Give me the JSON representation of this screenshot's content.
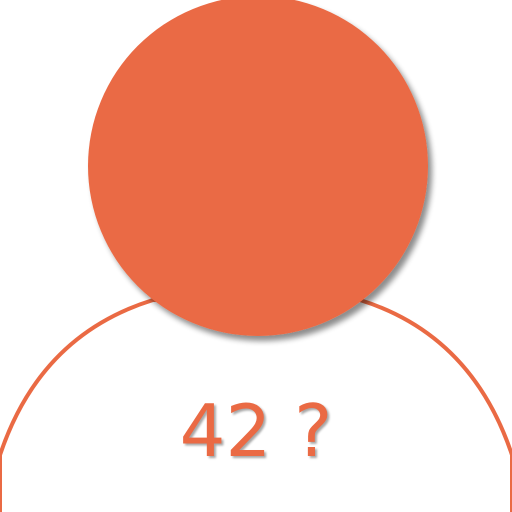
{
  "avatar": {
    "caption": "42 ?",
    "icon": "person-silhouette-icon",
    "accent_color": "#ea6a44",
    "background_color": "#ffffff"
  }
}
